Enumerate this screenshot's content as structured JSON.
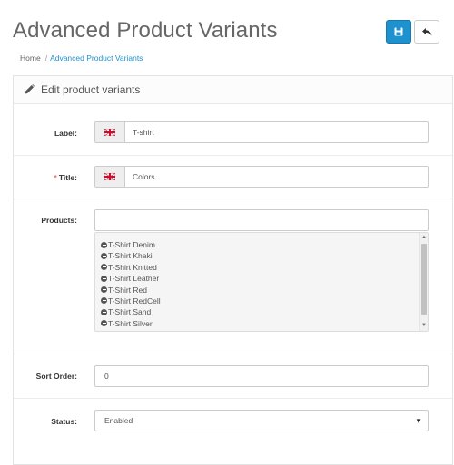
{
  "page": {
    "title": "Advanced Product Variants",
    "buttons": {
      "save_icon": "save-icon",
      "back_icon": "reply-icon"
    },
    "breadcrumb": [
      {
        "label": "Home"
      },
      {
        "label": "Advanced Product Variants"
      }
    ]
  },
  "panel": {
    "heading": "Edit product variants",
    "heading_icon": "pencil-icon"
  },
  "form": {
    "label": {
      "label": "Label:",
      "value": "T-shirt",
      "flag_icon": "english-flag-icon"
    },
    "title": {
      "required_mark": "*",
      "label": "Title:",
      "value": "Colors",
      "flag_icon": "english-flag-icon"
    },
    "products": {
      "label": "Products:",
      "input_value": "",
      "items": [
        "T-Shirt Denim",
        "T-Shirt Khaki",
        "T-Shirt Knitted",
        "T-Shirt Leather",
        "T-Shirt Red",
        "T-Shirt RedCell",
        "T-Shirt Sand",
        "T-Shirt Silver"
      ],
      "item_icon": "minus-circle-icon"
    },
    "sort_order": {
      "label": "Sort Order:",
      "value": "0"
    },
    "status": {
      "label": "Status:",
      "value": "Enabled"
    }
  },
  "colors": {
    "primary": "#1e91cf",
    "required": "#f56b6b"
  }
}
